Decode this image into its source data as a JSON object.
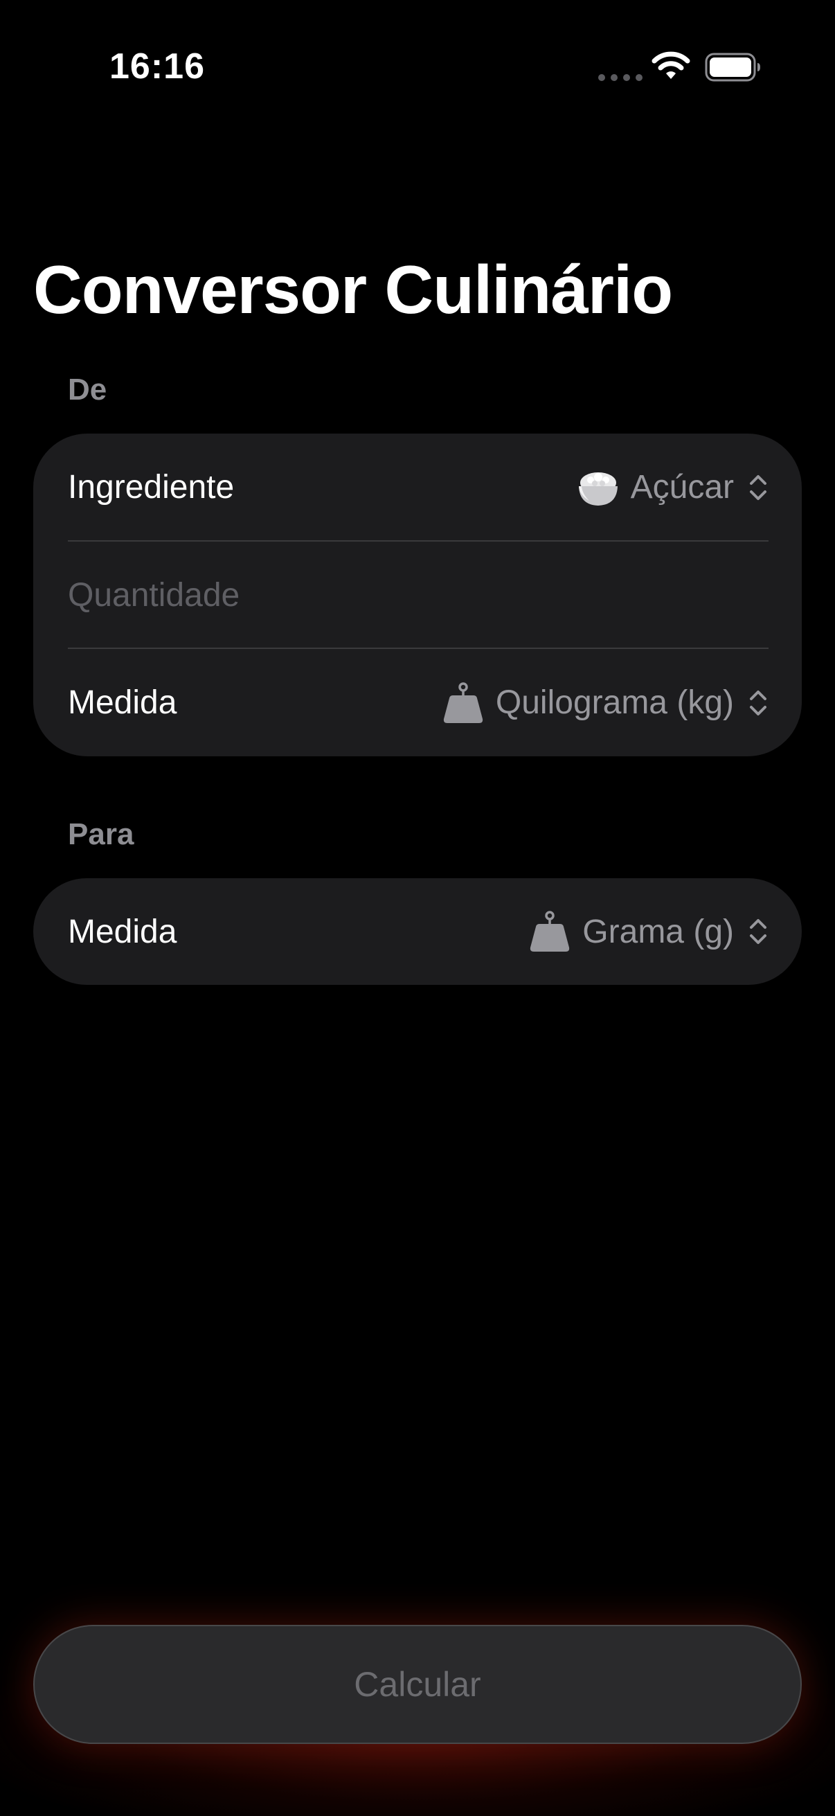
{
  "status_bar": {
    "time": "16:16",
    "icons": [
      "cellular-signal-icon",
      "wifi-icon",
      "battery-icon"
    ]
  },
  "title": "Conversor Culinário",
  "from_section": {
    "header": "De",
    "ingredient": {
      "label": "Ingrediente",
      "value": "Açúcar",
      "icon": "sugar-bowl-icon"
    },
    "quantity": {
      "value": "",
      "placeholder": "Quantidade"
    },
    "measure": {
      "label": "Medida",
      "value": "Quilograma (kg)",
      "icon": "weight-icon"
    }
  },
  "to_section": {
    "header": "Para",
    "measure": {
      "label": "Medida",
      "value": "Grama (g)",
      "icon": "weight-icon"
    }
  },
  "calculate_button": {
    "label": "Calcular",
    "enabled": false
  },
  "colors": {
    "background": "#000000",
    "card": "#1c1c1e",
    "secondary_text": "#8e8e93",
    "placeholder": "#5f5f64",
    "glow": "#7a140a"
  }
}
